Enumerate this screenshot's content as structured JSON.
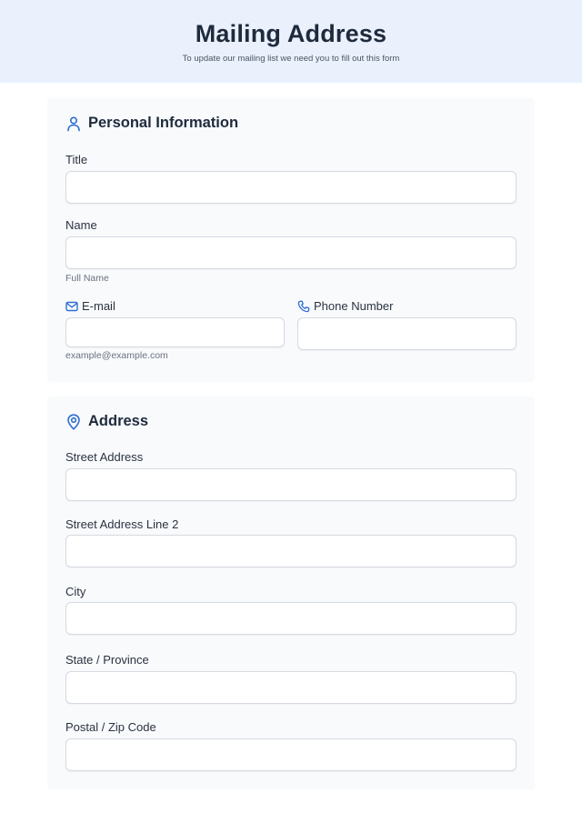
{
  "header": {
    "title": "Mailing Address",
    "subtitle": "To update our mailing list we need you to fill out this form"
  },
  "personal": {
    "section_title": "Personal Information",
    "section_icon": "person-icon",
    "title_label": "Title",
    "title_value": "",
    "name_label": "Name",
    "name_value": "",
    "name_sublabel": "Full Name",
    "email_label": "E-mail",
    "email_icon": "envelope-icon",
    "email_value": "",
    "email_sublabel": "example@example.com",
    "phone_label": "Phone Number",
    "phone_icon": "phone-icon",
    "phone_value": ""
  },
  "address": {
    "section_title": "Address",
    "section_icon": "map-pin-icon",
    "street_label": "Street Address",
    "street_value": "",
    "street2_label": "Street Address Line 2",
    "street2_value": "",
    "city_label": "City",
    "city_value": "",
    "state_label": "State / Province",
    "state_value": "",
    "postal_label": "Postal / Zip Code",
    "postal_value": ""
  },
  "colors": {
    "header_bg": "#eaf1fd",
    "card_bg": "#f8fafc",
    "accent": "#2f6fd0",
    "text": "#1f2a3c"
  }
}
